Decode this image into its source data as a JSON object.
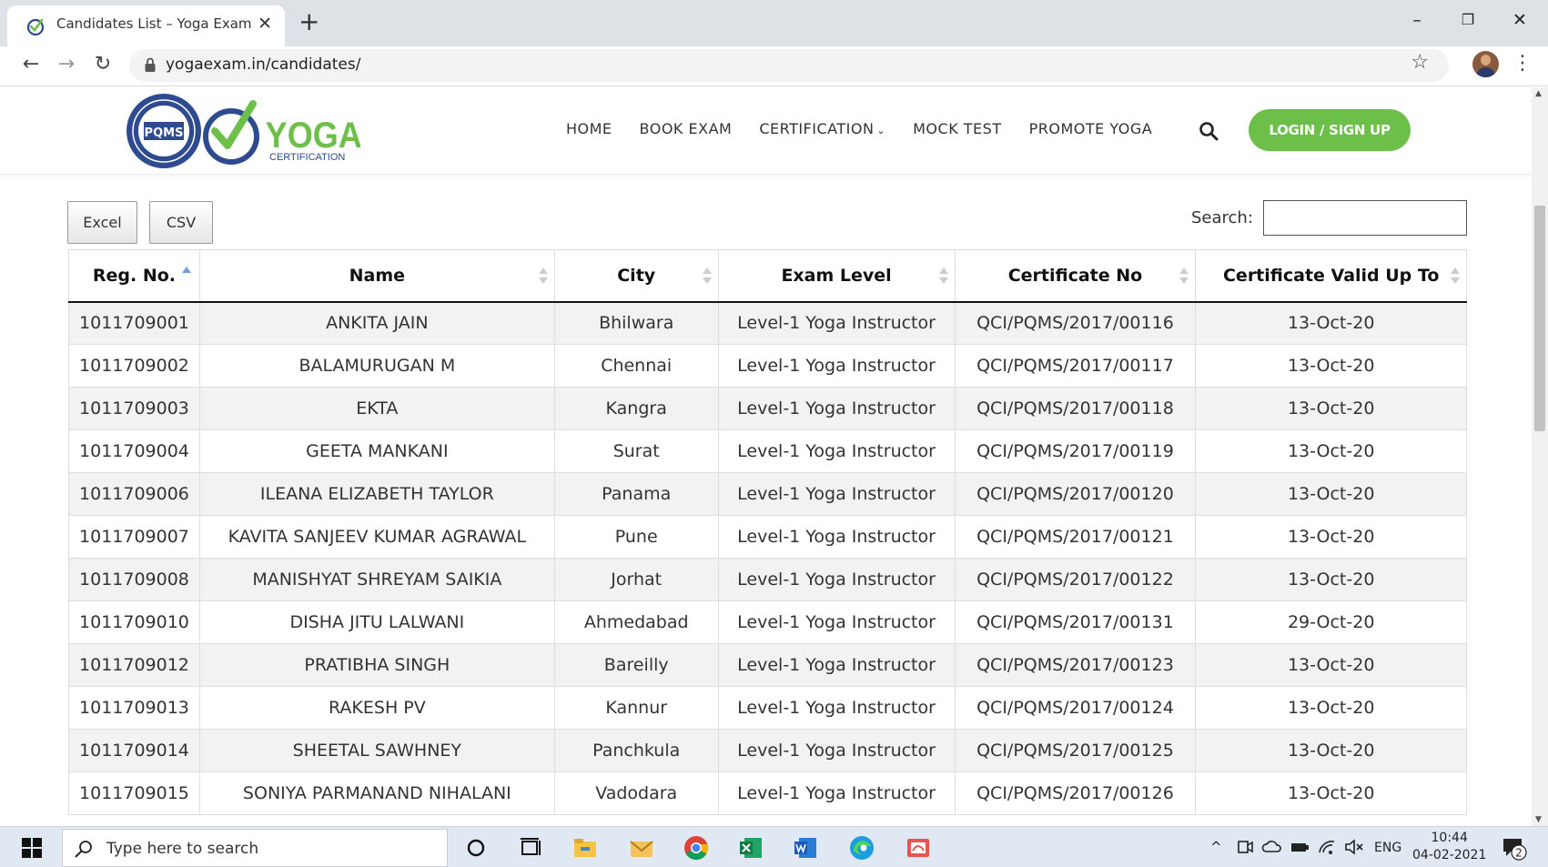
{
  "browser": {
    "tab_title": "Candidates List – Yoga Exam",
    "tab_close": "✕",
    "new_tab": "+",
    "url": "yogaexam.in/candidates/",
    "window_min": "–",
    "window_max": "❐",
    "window_close": "✕"
  },
  "site": {
    "logo_seal_text": "PQMS",
    "logo_word": "YOGA",
    "logo_sub": "CERTIFICATION",
    "nav": [
      {
        "label": "HOME"
      },
      {
        "label": "BOOK EXAM"
      },
      {
        "label": "CERTIFICATION"
      },
      {
        "label": "MOCK TEST"
      },
      {
        "label": "PROMOTE YOGA"
      }
    ],
    "login_label": "LOGIN / SIGN UP",
    "accent": "#6cc04a"
  },
  "table_controls": {
    "excel_label": "Excel",
    "csv_label": "CSV",
    "search_label": "Search:"
  },
  "table": {
    "headers": [
      "Reg. No.",
      "Name",
      "City",
      "Exam Level",
      "Certificate No",
      "Certificate Valid Up To"
    ],
    "rows": [
      [
        "1011709001",
        "ANKITA JAIN",
        "Bhilwara",
        "Level-1 Yoga Instructor",
        "QCI/PQMS/2017/00116",
        "13-Oct-20"
      ],
      [
        "1011709002",
        "BALAMURUGAN M",
        "Chennai",
        "Level-1 Yoga Instructor",
        "QCI/PQMS/2017/00117",
        "13-Oct-20"
      ],
      [
        "1011709003",
        "EKTA",
        "Kangra",
        "Level-1 Yoga Instructor",
        "QCI/PQMS/2017/00118",
        "13-Oct-20"
      ],
      [
        "1011709004",
        "GEETA MANKANI",
        "Surat",
        "Level-1 Yoga Instructor",
        "QCI/PQMS/2017/00119",
        "13-Oct-20"
      ],
      [
        "1011709006",
        "ILEANA ELIZABETH TAYLOR",
        "Panama",
        "Level-1 Yoga Instructor",
        "QCI/PQMS/2017/00120",
        "13-Oct-20"
      ],
      [
        "1011709007",
        "KAVITA SANJEEV KUMAR AGRAWAL",
        "Pune",
        "Level-1 Yoga Instructor",
        "QCI/PQMS/2017/00121",
        "13-Oct-20"
      ],
      [
        "1011709008",
        "MANISHYAT SHREYAM SAIKIA",
        "Jorhat",
        "Level-1 Yoga Instructor",
        "QCI/PQMS/2017/00122",
        "13-Oct-20"
      ],
      [
        "1011709010",
        "DISHA JITU LALWANI",
        "Ahmedabad",
        "Level-1 Yoga Instructor",
        "QCI/PQMS/2017/00131",
        "29-Oct-20"
      ],
      [
        "1011709012",
        "PRATIBHA SINGH",
        "Bareilly",
        "Level-1 Yoga Instructor",
        "QCI/PQMS/2017/00123",
        "13-Oct-20"
      ],
      [
        "1011709013",
        "RAKESH PV",
        "Kannur",
        "Level-1 Yoga Instructor",
        "QCI/PQMS/2017/00124",
        "13-Oct-20"
      ],
      [
        "1011709014",
        "SHEETAL SAWHNEY",
        "Panchkula",
        "Level-1 Yoga Instructor",
        "QCI/PQMS/2017/00125",
        "13-Oct-20"
      ],
      [
        "1011709015",
        "SONIYA PARMANAND NIHALANI",
        "Vadodara",
        "Level-1 Yoga Instructor",
        "QCI/PQMS/2017/00126",
        "13-Oct-20"
      ]
    ]
  },
  "taskbar": {
    "search_placeholder": "Type here to search",
    "language": "ENG",
    "time": "10:44",
    "date": "04-02-2021",
    "notification_count": "2"
  }
}
